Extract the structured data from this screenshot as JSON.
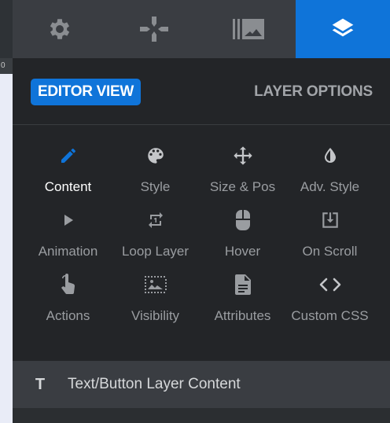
{
  "ruler": {
    "mark": "0"
  },
  "top_tabs": [
    {
      "name": "settings",
      "icon": "gear-icon"
    },
    {
      "name": "controls",
      "icon": "gamepad-icon"
    },
    {
      "name": "media",
      "icon": "gallery-icon"
    },
    {
      "name": "layers",
      "icon": "layers-icon",
      "active": true
    }
  ],
  "header": {
    "editor_view": "EDITOR VIEW",
    "layer_options": "LAYER OPTIONS"
  },
  "options": [
    {
      "label": "Content",
      "icon": "pencil-icon",
      "active": true
    },
    {
      "label": "Style",
      "icon": "palette-icon"
    },
    {
      "label": "Size & Pos",
      "icon": "move-arrows-icon"
    },
    {
      "label": "Adv. Style",
      "icon": "contrast-drop-icon"
    },
    {
      "label": "Animation",
      "icon": "play-icon"
    },
    {
      "label": "Loop Layer",
      "icon": "repeat-icon"
    },
    {
      "label": "Hover",
      "icon": "mouse-icon"
    },
    {
      "label": "On Scroll",
      "icon": "scroll-download-icon"
    },
    {
      "label": "Actions",
      "icon": "pointer-hand-icon"
    },
    {
      "label": "Visibility",
      "icon": "visibility-image-icon"
    },
    {
      "label": "Attributes",
      "icon": "document-icon"
    },
    {
      "label": "Custom CSS",
      "icon": "code-icon"
    }
  ],
  "section": {
    "icon_letter": "T",
    "title": "Text/Button Layer Content"
  },
  "colors": {
    "accent": "#0f74d9",
    "panel_bg": "#232528",
    "tabbar_bg": "#3a3d42",
    "inactive_text": "#9a9da1",
    "active_text": "#ffffff"
  }
}
